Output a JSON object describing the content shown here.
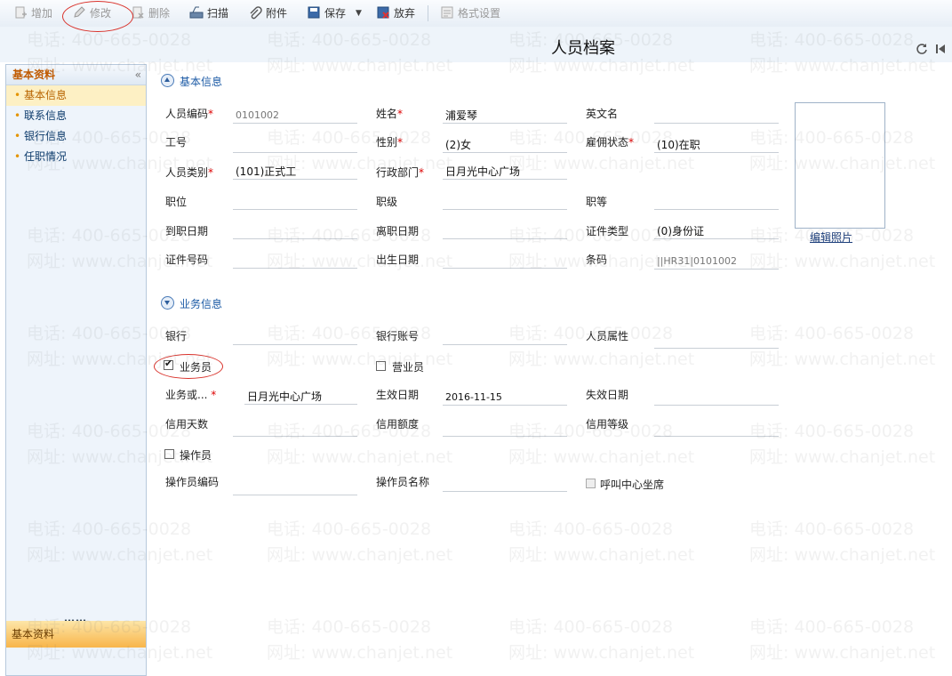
{
  "toolbar": {
    "add": "增加",
    "edit": "修改",
    "delete": "删除",
    "scan": "扫描",
    "attach": "附件",
    "save": "保存",
    "discard": "放弃",
    "format": "格式设置"
  },
  "title": "人员档案",
  "sidebar": {
    "header": "基本资料",
    "collapse": "«",
    "items": [
      "基本信息",
      "联系信息",
      "银行信息",
      "任职情况"
    ],
    "dots": "……",
    "footer": "基本资料"
  },
  "basic": {
    "section": "基本信息",
    "emp_code_label": "人员编码",
    "emp_code": "0101002",
    "name_label": "姓名",
    "name": "浦爱琴",
    "en_name_label": "英文名",
    "en_name": "",
    "job_no_label": "工号",
    "gender_label": "性别",
    "gender": "(2)女",
    "status_label": "雇佣状态",
    "status": "(10)在职",
    "category_label": "人员类别",
    "category": "(101)正式工",
    "dept_label": "行政部门",
    "dept": "日月光中心广场",
    "position_label": "职位",
    "grade_label": "职级",
    "rank_label": "职等",
    "hire_date_label": "到职日期",
    "leave_date_label": "离职日期",
    "id_type_label": "证件类型",
    "id_type": "(0)身份证",
    "id_no_label": "证件号码",
    "birth_label": "出生日期",
    "barcode_label": "条码",
    "barcode": "||HR31|0101002",
    "photo_link": "编辑照片",
    "required_mark": "*"
  },
  "business": {
    "section": "业务信息",
    "bank_label": "银行",
    "account_label": "银行账号",
    "attr_label": "人员属性",
    "salesman_label": "业务员",
    "clerk_label": "营业员",
    "dept_label": "业务或...",
    "dept": "日月光中心广场",
    "start_label": "生效日期",
    "start": "2016-11-15",
    "end_label": "失效日期",
    "credit_days_label": "信用天数",
    "credit_amount_label": "信用额度",
    "credit_level_label": "信用等级",
    "operator_label": "操作员",
    "operator_code_label": "操作员编码",
    "operator_name_label": "操作员名称",
    "callcenter_label": "呼叫中心坐席"
  },
  "checkboxes": {
    "salesman": true,
    "clerk": false,
    "operator": false,
    "callcenter": false
  },
  "watermark": {
    "phone": "电话: 400-665-0028",
    "site": "网址: www.chanjet.net"
  },
  "colors": {
    "accent": "#1b5aa5",
    "required": "#dd0000",
    "sidebar_active": "#fdf0c4",
    "annotation_circle": "#d9322b"
  }
}
